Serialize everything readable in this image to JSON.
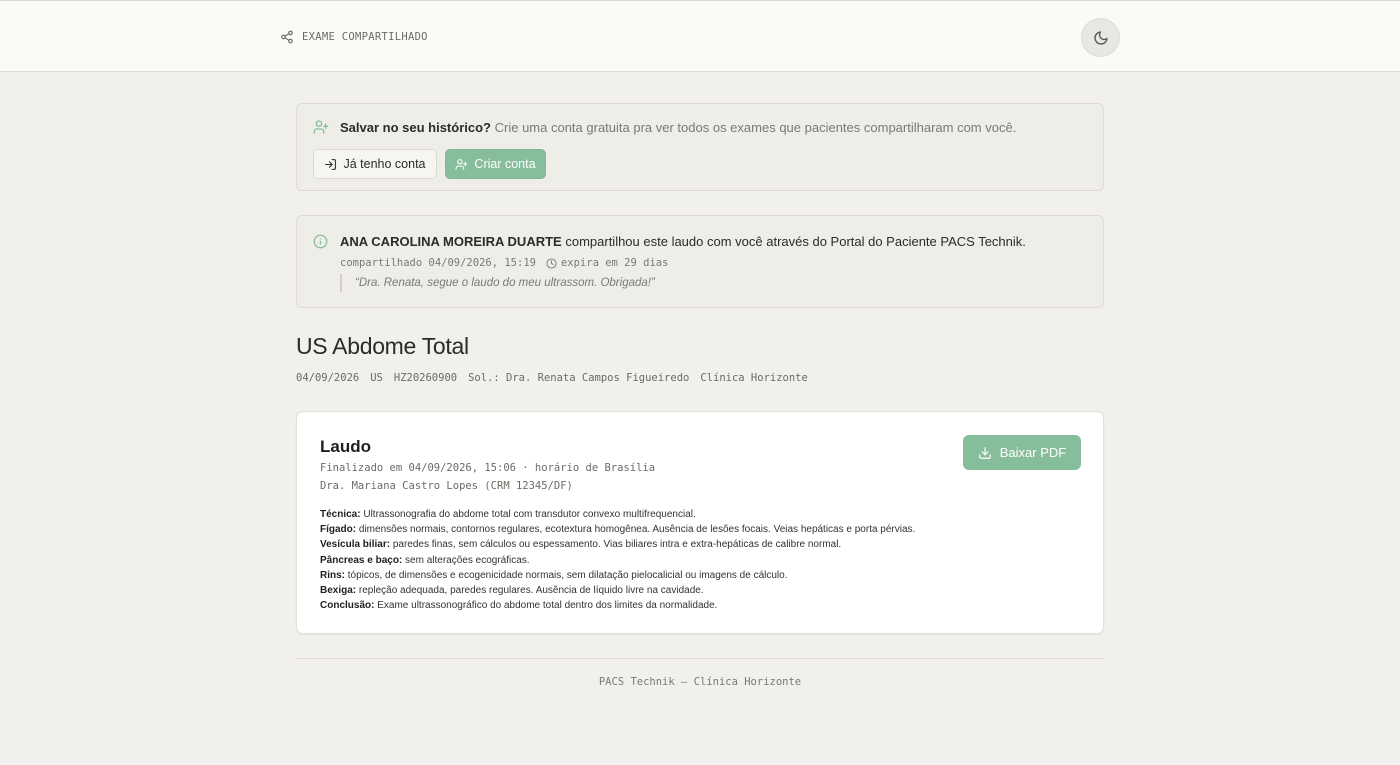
{
  "header": {
    "brand_label": "EXAME COMPARTILHADO",
    "theme_toggle_icon": "moon-icon"
  },
  "save_prompt": {
    "title": "Salvar no seu histórico?",
    "description": "Crie uma conta gratuita pra ver todos os exames que pacientes compartilharam com você.",
    "login_label": "Já tenho conta",
    "signup_label": "Criar conta"
  },
  "share_info": {
    "sender_name": "ANA CAROLINA MOREIRA DUARTE",
    "message": "compartilhou este laudo com você através do Portal do Paciente PACS Technik.",
    "shared_at": "compartilhado 04/09/2026, 15:19",
    "expires": "expira em 29 dias",
    "note": "“Dra. Renata, segue o laudo do meu ultrassom. Obrigada!”"
  },
  "exam": {
    "title": "US Abdome Total",
    "date": "04/09/2026",
    "modality": "US",
    "accession": "HZ20260900",
    "requester": "Sol.: Dra. Renata Campos Figueiredo",
    "clinic": "Clínica Horizonte"
  },
  "report": {
    "heading": "Laudo",
    "finalized": "Finalizado em 04/09/2026, 15:06 · horário de Brasília",
    "doctor": "Dra. Mariana Castro Lopes (CRM 12345/DF)",
    "download_label": "Baixar PDF",
    "findings": [
      {
        "label": "Técnica:",
        "text": "Ultrassonografia do abdome total com transdutor convexo multifrequencial."
      },
      {
        "label": "Fígado:",
        "text": "dimensões normais, contornos regulares, ecotextura homogênea. Ausência de lesões focais. Veias hepáticas e porta pérvias."
      },
      {
        "label": "Vesícula biliar:",
        "text": "paredes finas, sem cálculos ou espessamento. Vias biliares intra e extra-hepáticas de calibre normal."
      },
      {
        "label": "Pâncreas e baço:",
        "text": "sem alterações ecográficas."
      },
      {
        "label": "Rins:",
        "text": "tópicos, de dimensões e ecogenicidade normais, sem dilatação pielocalicial ou imagens de cálculo."
      },
      {
        "label": "Bexiga:",
        "text": "repleção adequada, paredes regulares. Ausência de líquido livre na cavidade."
      },
      {
        "label": "Conclusão:",
        "text": "Exame ultrassonográfico do abdome total dentro dos limites da normalidade."
      }
    ]
  },
  "footer": {
    "text": "PACS Technik — Clínica Horizonte"
  },
  "colors": {
    "accent": "#86bd9a",
    "background": "#f1f0ec",
    "card": "#eeede8"
  }
}
